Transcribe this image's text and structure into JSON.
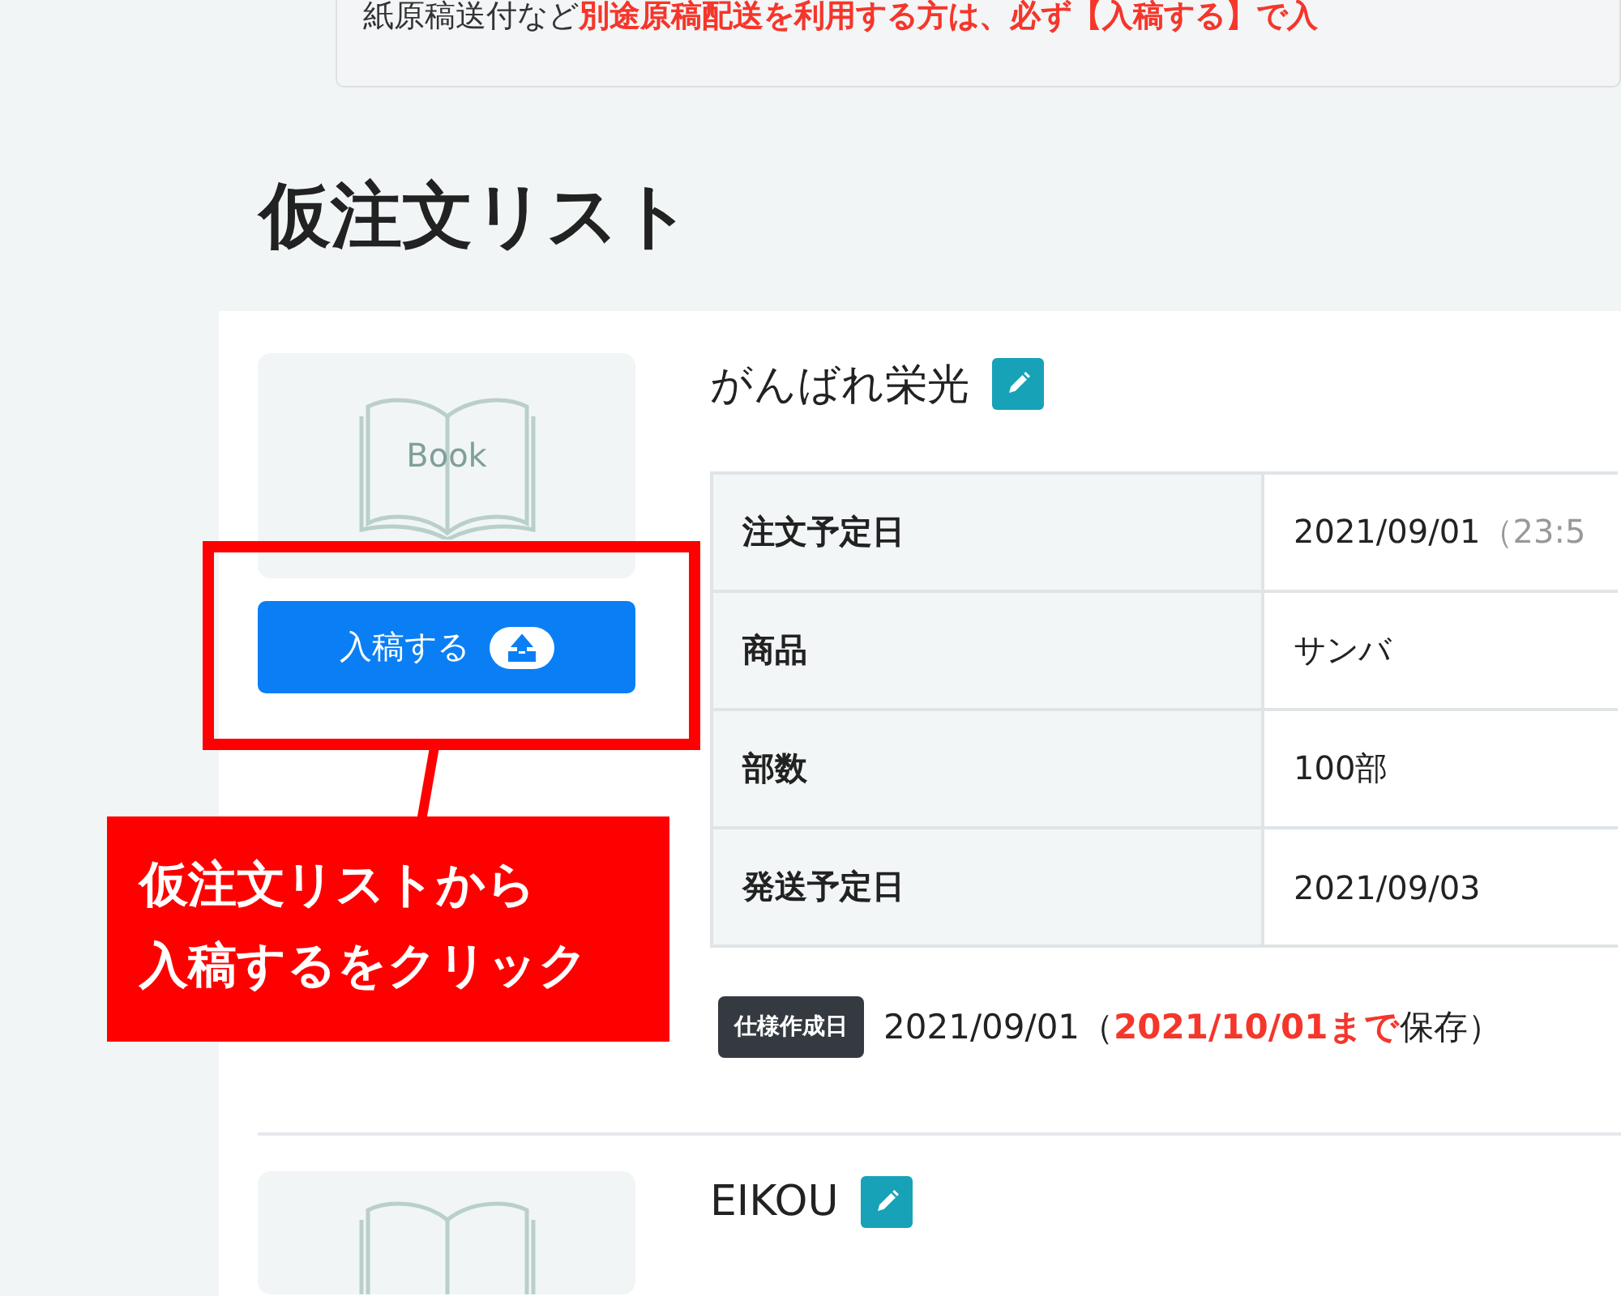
{
  "notice": {
    "text": "紙原稿送付など**別途原稿配送を利用する方は、必ず【入稿する】で入**"
  },
  "page_title": "仮注文リスト",
  "orders": [
    {
      "title": "がんばれ栄光",
      "thumbnail": {
        "label": "Book"
      },
      "upload_button": "入稿する",
      "details": [
        {
          "label": "注文予定日",
          "value": "2021/09/01",
          "note": "（23:5"
        },
        {
          "label": "商品",
          "value": "サンバ"
        },
        {
          "label": "部数",
          "value": "100部"
        },
        {
          "label": "発送予定日",
          "value": "2021/09/03"
        }
      ],
      "spec": {
        "badge": "仕様作成日",
        "text": "2021/09/01（**2021/10/01まで**保存）"
      }
    },
    {
      "title": "EIKOU"
    }
  ],
  "annotation": {
    "lines": [
      "仮注文リストから",
      "入稿するをクリック"
    ]
  }
}
